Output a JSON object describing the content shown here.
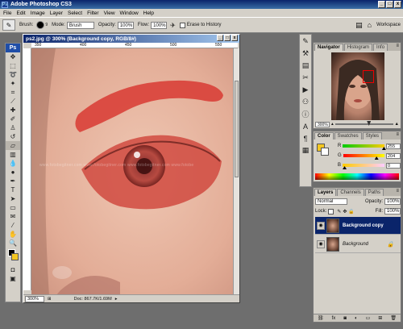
{
  "app": {
    "title": "Adobe Photoshop CS3",
    "window_buttons": [
      "_",
      "□",
      "x"
    ]
  },
  "menu": [
    "File",
    "Edit",
    "Image",
    "Layer",
    "Select",
    "Filter",
    "View",
    "Window",
    "Help"
  ],
  "options": {
    "brush_label": "Brush:",
    "brush_size": "9",
    "mode_label": "Mode:",
    "mode_value": "Brush",
    "opacity_label": "Opacity:",
    "opacity_value": "100%",
    "flow_label": "Flow:",
    "flow_value": "100%",
    "erase_label": "Erase to History",
    "workspace_label": "Workspace"
  },
  "document": {
    "title": "ps2.jpg @ 300% (Background copy, RGB/8#)",
    "zoom": "300%",
    "doc_size": "Doc: 867.7K/1.69M",
    "ruler_ticks": [
      "350",
      "400",
      "450",
      "500",
      "550"
    ],
    "watermark": "www.fotobegitner.com   www.fotobegitner.com   www.fotobegitner.com   www.fotobe"
  },
  "navigator": {
    "tabs": [
      "Navigator",
      "Histogram",
      "Info"
    ],
    "zoom": "300%"
  },
  "color_panel": {
    "tabs": [
      "Color",
      "Swatches",
      "Styles"
    ],
    "r_label": "R",
    "g_label": "G",
    "b_label": "B",
    "r_value": "255",
    "g_value": "204",
    "b_value": "0",
    "fg_color": "#f4c721"
  },
  "layers_panel": {
    "tabs": [
      "Layers",
      "Channels",
      "Paths"
    ],
    "blend_mode": "Normal",
    "opacity_label": "Opacity:",
    "opacity_value": "100%",
    "lock_label": "Lock:",
    "fill_label": "Fill:",
    "fill_value": "100%",
    "layers": [
      {
        "name": "Background copy",
        "selected": true
      },
      {
        "name": "Background",
        "selected": false
      }
    ]
  },
  "colors": {
    "selection_red": "#d83a32",
    "title_blue": "#0a246a"
  }
}
